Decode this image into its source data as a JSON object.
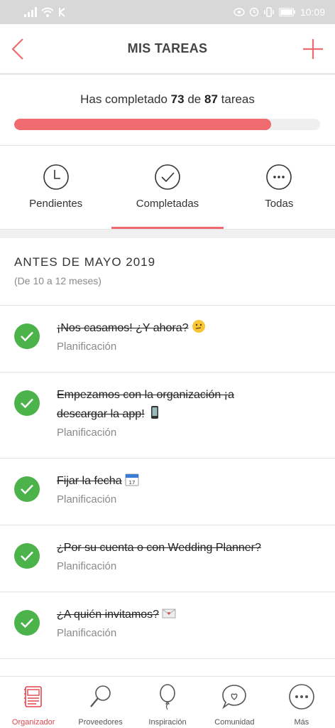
{
  "status_bar": {
    "time": "10:09"
  },
  "header": {
    "title": "MIS TAREAS"
  },
  "progress": {
    "prefix": "Has completado",
    "completed": "73",
    "connector": "de",
    "total": "87",
    "suffix": "tareas",
    "fraction": 0.839
  },
  "tabs": [
    {
      "label": "Pendientes",
      "icon": "clock-icon"
    },
    {
      "label": "Completadas",
      "icon": "check-circle-icon"
    },
    {
      "label": "Todas",
      "icon": "more-icon"
    }
  ],
  "section": {
    "title": "ANTES DE MAYO 2019",
    "subtitle": "(De 10 a 12 meses)"
  },
  "tasks": [
    {
      "title_line1": "¡Nos casamos! ¿Y ahora?",
      "title_line2": "",
      "emoji": "thinking-face-emoji",
      "category": "Planificación"
    },
    {
      "title_line1": "Empezamos con la organización ¡a",
      "title_line2": "descargar la app!",
      "emoji": "mobile-phone-emoji",
      "category": "Planificación"
    },
    {
      "title_line1": "Fijar la fecha",
      "title_line2": "",
      "emoji": "calendar-emoji",
      "category": "Planificación"
    },
    {
      "title_line1": "¿Por su cuenta o con Wedding Planner?",
      "title_line2": "",
      "emoji": "",
      "category": "Planificación"
    },
    {
      "title_line1": "¿A quién invitamos?",
      "title_line2": "",
      "emoji": "love-letter-emoji",
      "category": "Planificación"
    }
  ],
  "bottom_nav": [
    {
      "label": "Organizador",
      "icon": "organizer-icon",
      "active": true
    },
    {
      "label": "Proveedores",
      "icon": "magnifier-icon",
      "active": false
    },
    {
      "label": "Inspiración",
      "icon": "balloon-icon",
      "active": false
    },
    {
      "label": "Comunidad",
      "icon": "chat-heart-icon",
      "active": false
    },
    {
      "label": "Más",
      "icon": "more-icon",
      "active": false
    }
  ],
  "colors": {
    "accent": "#f06b70",
    "check": "#4cb34a",
    "active_nav": "#e0464c"
  }
}
